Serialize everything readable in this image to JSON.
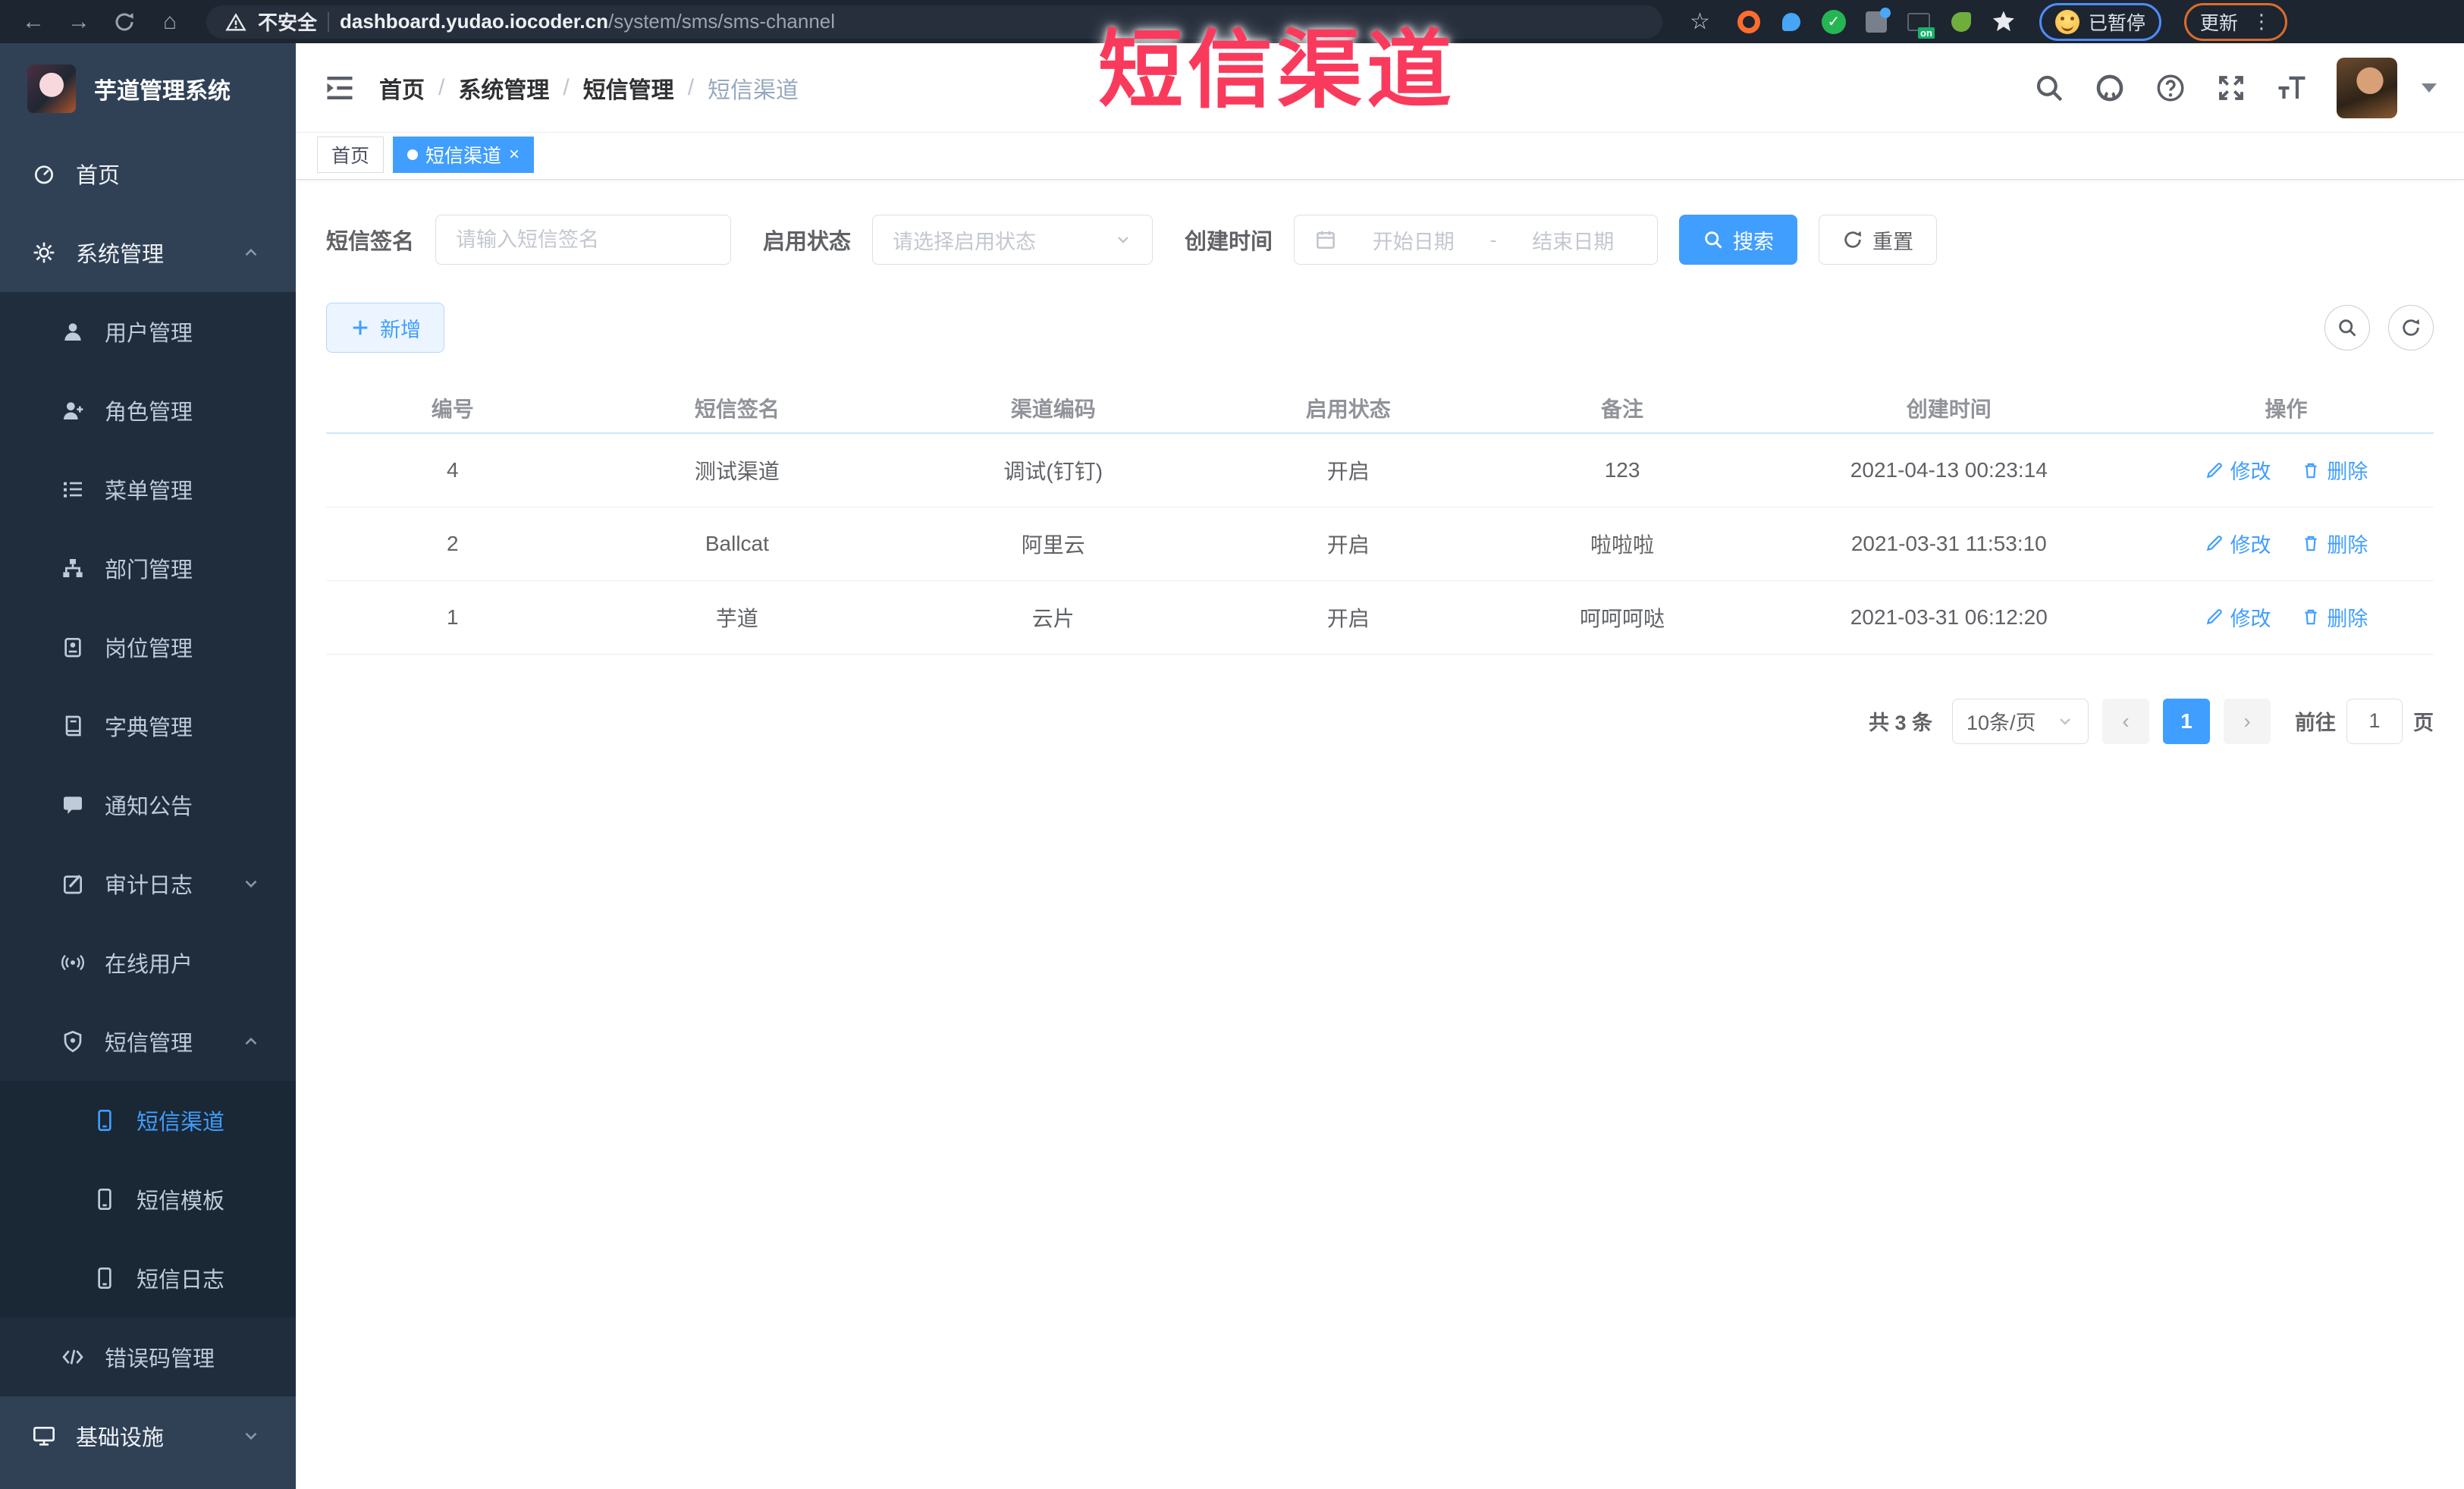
{
  "browser": {
    "security_label": "不安全",
    "url_host": "dashboard.yudao.iocoder.cn",
    "url_path": "/system/sms/sms-channel",
    "paused_label": "已暂停",
    "update_label": "更新"
  },
  "overlay": {
    "watermark_text": "短信渠道",
    "watermark_color": "#fa3a5c"
  },
  "sidebar": {
    "logo_title": "芋道管理系统",
    "items": [
      {
        "label": "首页",
        "icon": "dashboard-icon",
        "level": 1
      },
      {
        "label": "系统管理",
        "icon": "gear-icon",
        "level": 1,
        "state": "expanded"
      },
      {
        "label": "用户管理",
        "icon": "user-icon",
        "level": 2
      },
      {
        "label": "角色管理",
        "icon": "role-icon",
        "level": 2
      },
      {
        "label": "菜单管理",
        "icon": "menu-list-icon",
        "level": 2
      },
      {
        "label": "部门管理",
        "icon": "org-tree-icon",
        "level": 2
      },
      {
        "label": "岗位管理",
        "icon": "post-icon",
        "level": 2
      },
      {
        "label": "字典管理",
        "icon": "dict-book-icon",
        "level": 2
      },
      {
        "label": "通知公告",
        "icon": "notice-icon",
        "level": 2
      },
      {
        "label": "审计日志",
        "icon": "audit-log-icon",
        "level": 2,
        "state": "collapsed"
      },
      {
        "label": "在线用户",
        "icon": "online-user-icon",
        "level": 2
      },
      {
        "label": "短信管理",
        "icon": "sms-shield-icon",
        "level": 2,
        "state": "expanded"
      },
      {
        "label": "短信渠道",
        "icon": "phone-icon",
        "level": 3,
        "active": true
      },
      {
        "label": "短信模板",
        "icon": "phone-icon",
        "level": 3
      },
      {
        "label": "短信日志",
        "icon": "phone-icon",
        "level": 3
      },
      {
        "label": "错误码管理",
        "icon": "code-icon",
        "level": 2
      },
      {
        "label": "基础设施",
        "icon": "monitor-icon",
        "level": 1,
        "state": "collapsed"
      }
    ]
  },
  "breadcrumb": {
    "items": [
      "首页",
      "系统管理",
      "短信管理",
      "短信渠道"
    ],
    "separator": "/"
  },
  "tabs": [
    {
      "label": "首页"
    },
    {
      "label": "短信渠道",
      "active": true,
      "close": "×"
    }
  ],
  "filters": {
    "sign_label": "短信签名",
    "sign_placeholder": "请输入短信签名",
    "status_label": "启用状态",
    "status_placeholder": "请选择启用状态",
    "time_label": "创建时间",
    "start_placeholder": "开始日期",
    "range_separator": "-",
    "end_placeholder": "结束日期",
    "search_label": "搜索",
    "reset_label": "重置"
  },
  "toolbar": {
    "add_label": "新增"
  },
  "table": {
    "columns": [
      "编号",
      "短信签名",
      "渠道编码",
      "启用状态",
      "备注",
      "创建时间",
      "操作"
    ],
    "edit_label": "修改",
    "delete_label": "删除",
    "rows": [
      {
        "id": "4",
        "sign": "测试渠道",
        "code": "调试(钉钉)",
        "status": "开启",
        "remark": "123",
        "created": "2021-04-13 00:23:14"
      },
      {
        "id": "2",
        "sign": "Ballcat",
        "code": "阿里云",
        "status": "开启",
        "remark": "啦啦啦",
        "created": "2021-03-31 11:53:10"
      },
      {
        "id": "1",
        "sign": "芋道",
        "code": "云片",
        "status": "开启",
        "remark": "呵呵呵哒",
        "created": "2021-03-31 06:12:20"
      }
    ]
  },
  "pagination": {
    "total_label": "共 3 条",
    "page_size": "10条/页",
    "prev": "‹",
    "current_page": "1",
    "next": "›",
    "goto_label": "前往",
    "goto_value": "1",
    "page_unit": "页"
  },
  "colors": {
    "accent": "#409eff",
    "sidebar_bg": "#304156",
    "submenu_bg": "#1f2d3d",
    "active_tab_bg": "#409eff",
    "watermark": "#fa3a5c"
  }
}
